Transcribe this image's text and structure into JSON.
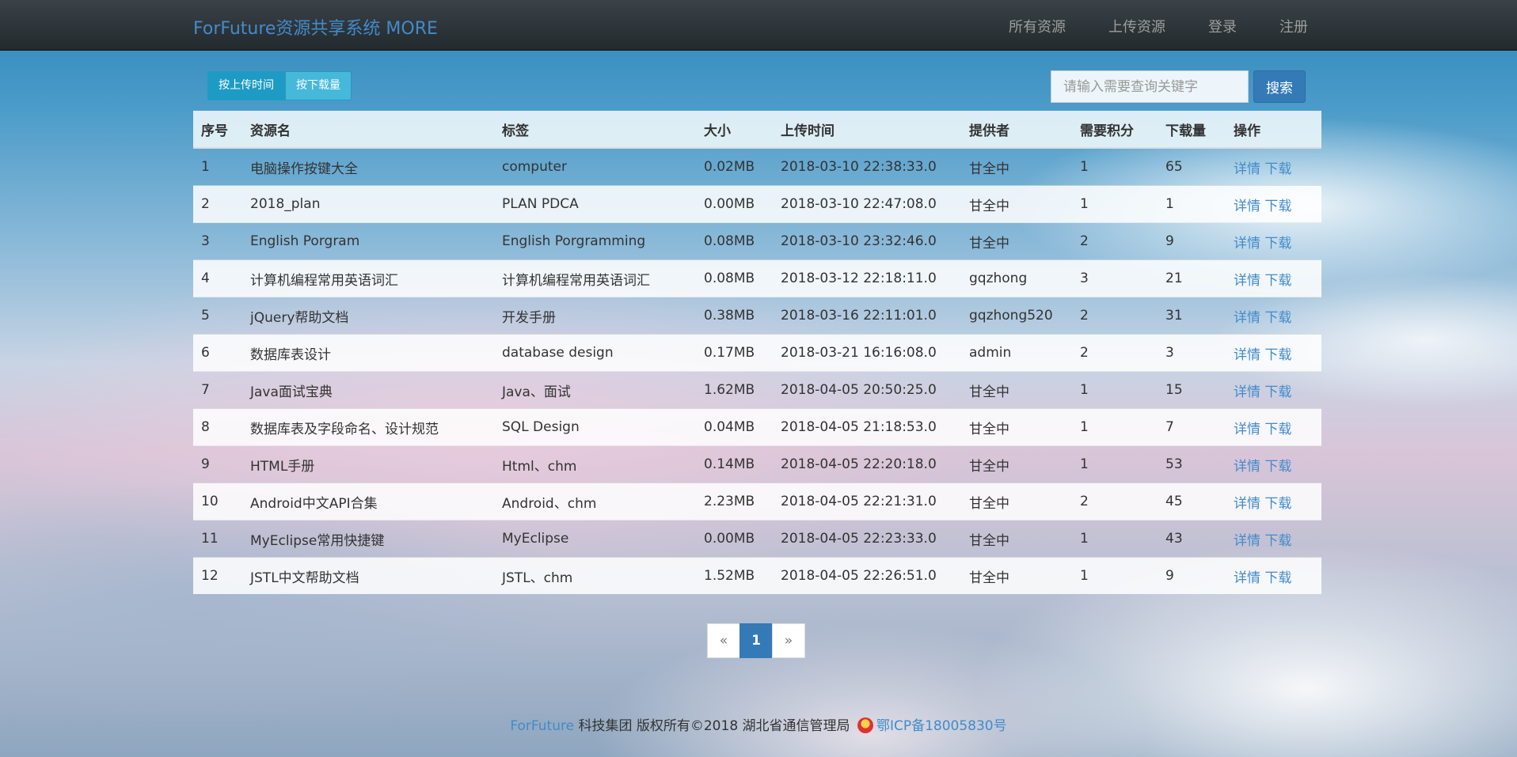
{
  "navbar": {
    "brand": "ForFuture资源共享系统 MORE",
    "links": [
      "所有资源",
      "上传资源",
      "登录",
      "注册"
    ]
  },
  "sort": {
    "by_upload_time": "按上传时间",
    "by_downloads": "按下载量"
  },
  "search": {
    "placeholder": "请输入需要查询关键字",
    "button": "搜索"
  },
  "table": {
    "headers": [
      "序号",
      "资源名",
      "标签",
      "大小",
      "上传时间",
      "提供者",
      "需要积分",
      "下载量",
      "操作"
    ],
    "action_detail": "详情",
    "action_download": "下载",
    "rows": [
      {
        "no": "1",
        "name": "电脑操作按键大全",
        "tag": "computer",
        "size": "0.02MB",
        "time": "2018-03-10 22:38:33.0",
        "provider": "甘全中",
        "points": "1",
        "downloads": "65"
      },
      {
        "no": "2",
        "name": "2018_plan",
        "tag": "PLAN PDCA",
        "size": "0.00MB",
        "time": "2018-03-10 22:47:08.0",
        "provider": "甘全中",
        "points": "1",
        "downloads": "1"
      },
      {
        "no": "3",
        "name": "English Porgram",
        "tag": "English Porgramming",
        "size": "0.08MB",
        "time": "2018-03-10 23:32:46.0",
        "provider": "甘全中",
        "points": "2",
        "downloads": "9"
      },
      {
        "no": "4",
        "name": "计算机编程常用英语词汇",
        "tag": "计算机编程常用英语词汇",
        "size": "0.08MB",
        "time": "2018-03-12 22:18:11.0",
        "provider": "gqzhong",
        "points": "3",
        "downloads": "21"
      },
      {
        "no": "5",
        "name": "jQuery帮助文档",
        "tag": "开发手册",
        "size": "0.38MB",
        "time": "2018-03-16 22:11:01.0",
        "provider": "gqzhong520",
        "points": "2",
        "downloads": "31"
      },
      {
        "no": "6",
        "name": "数据库表设计",
        "tag": "database design",
        "size": "0.17MB",
        "time": "2018-03-21 16:16:08.0",
        "provider": "admin",
        "points": "2",
        "downloads": "3"
      },
      {
        "no": "7",
        "name": "Java面试宝典",
        "tag": "Java、面试",
        "size": "1.62MB",
        "time": "2018-04-05 20:50:25.0",
        "provider": "甘全中",
        "points": "1",
        "downloads": "15"
      },
      {
        "no": "8",
        "name": "数据库表及字段命名、设计规范",
        "tag": "SQL Design",
        "size": "0.04MB",
        "time": "2018-04-05 21:18:53.0",
        "provider": "甘全中",
        "points": "1",
        "downloads": "7"
      },
      {
        "no": "9",
        "name": "HTML手册",
        "tag": "Html、chm",
        "size": "0.14MB",
        "time": "2018-04-05 22:20:18.0",
        "provider": "甘全中",
        "points": "1",
        "downloads": "53"
      },
      {
        "no": "10",
        "name": "Android中文API合集",
        "tag": "Android、chm",
        "size": "2.23MB",
        "time": "2018-04-05 22:21:31.0",
        "provider": "甘全中",
        "points": "2",
        "downloads": "45"
      },
      {
        "no": "11",
        "name": "MyEclipse常用快捷键",
        "tag": "MyEclipse",
        "size": "0.00MB",
        "time": "2018-04-05 22:23:33.0",
        "provider": "甘全中",
        "points": "1",
        "downloads": "43"
      },
      {
        "no": "12",
        "name": "JSTL中文帮助文档",
        "tag": "JSTL、chm",
        "size": "1.52MB",
        "time": "2018-04-05 22:26:51.0",
        "provider": "甘全中",
        "points": "1",
        "downloads": "9"
      }
    ]
  },
  "pagination": {
    "prev": "«",
    "current": "1",
    "next": "»"
  },
  "footer": {
    "brand": "ForFuture",
    "text": " 科技集团 版权所有©2018 湖北省通信管理局 ",
    "icp": "鄂ICP备18005830号"
  },
  "colors": {
    "link": "#428bca",
    "primary": "#337ab7",
    "info": "#31b0d5",
    "navbar": "#222a2e"
  }
}
